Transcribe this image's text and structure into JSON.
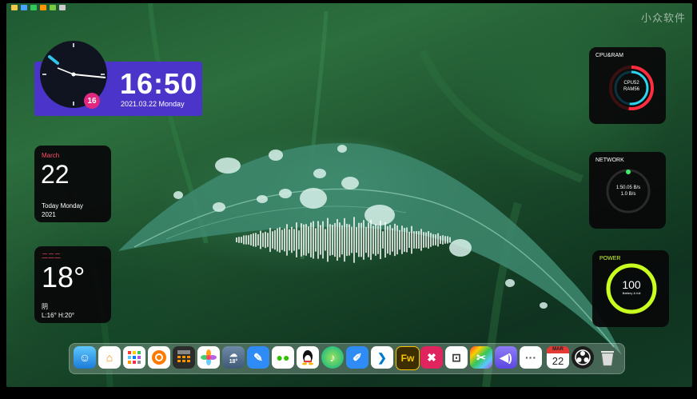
{
  "clock": {
    "time": "16:50",
    "date": "2021.03.22 Monday",
    "badge": "16"
  },
  "calendar": {
    "month": "March",
    "day": "22",
    "weekday_line": "Today Monday",
    "year": "2021"
  },
  "weather": {
    "city": "二二二",
    "temp": "18°",
    "condition": "阴",
    "range": "L:16° H:20°"
  },
  "cpu_ram": {
    "title": "CPU&RAM",
    "cpu": "CPU52",
    "ram": "RAM56"
  },
  "network": {
    "title": "NETWORK",
    "up": "1:50.05 B/s",
    "down": "1.0 B/s"
  },
  "power": {
    "title": "POWER",
    "value": "100",
    "sub": "Battery & full"
  },
  "watermark": "小众软件",
  "dock": {
    "weather_temp": "18°",
    "calendar_month": "MAR",
    "calendar_day": "22",
    "fw_label": "Fw",
    "apps": [
      "finder-icon",
      "home-icon",
      "launchpad-icon",
      "firefox-icon",
      "calculator-icon",
      "photos-icon",
      "weather-icon",
      "notes-icon",
      "wechat-icon",
      "qq-icon",
      "music-icon",
      "pen-icon",
      "vscode-icon",
      "fireworks-icon",
      "xmind-icon",
      "screenshot-icon",
      "color-icon",
      "audio-icon",
      "more-icon",
      "calendar-icon",
      "obs-icon",
      "trash-icon"
    ]
  }
}
